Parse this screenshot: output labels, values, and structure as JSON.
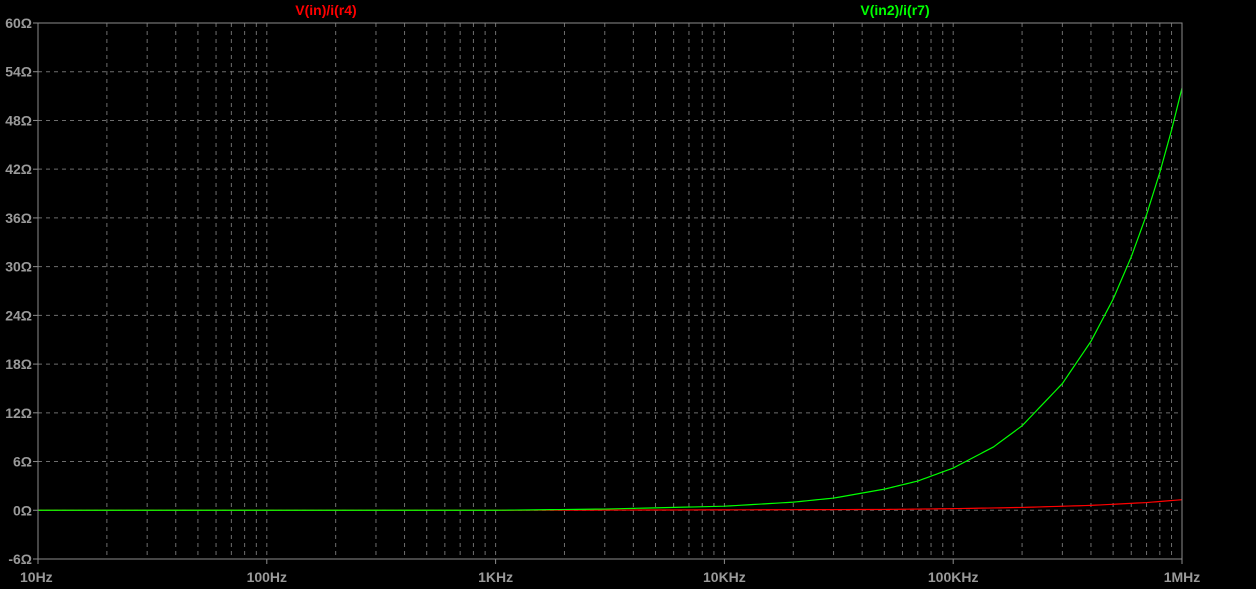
{
  "chart_data": {
    "type": "line",
    "x_scale": "log",
    "xlim": [
      10,
      1000000
    ],
    "ylim": [
      -6,
      60
    ],
    "grid": true,
    "x_ticks": [
      {
        "value": 10,
        "label": "10Hz"
      },
      {
        "value": 100,
        "label": "100Hz"
      },
      {
        "value": 1000,
        "label": "1KHz"
      },
      {
        "value": 10000,
        "label": "10KHz"
      },
      {
        "value": 100000,
        "label": "100KHz"
      },
      {
        "value": 1000000,
        "label": "1MHz"
      }
    ],
    "y_ticks": [
      {
        "value": -6,
        "label": "-6Ω"
      },
      {
        "value": 0,
        "label": "0Ω"
      },
      {
        "value": 6,
        "label": "6Ω"
      },
      {
        "value": 12,
        "label": "12Ω"
      },
      {
        "value": 18,
        "label": "18Ω"
      },
      {
        "value": 24,
        "label": "24Ω"
      },
      {
        "value": 30,
        "label": "30Ω"
      },
      {
        "value": 36,
        "label": "36Ω"
      },
      {
        "value": 42,
        "label": "42Ω"
      },
      {
        "value": 48,
        "label": "48Ω"
      },
      {
        "value": 54,
        "label": "54Ω"
      },
      {
        "value": 60,
        "label": "60Ω"
      }
    ],
    "series": [
      {
        "name": "V(in)/i(r4)",
        "color": "#ff0000",
        "x": [
          10,
          100,
          1000,
          10000,
          50000,
          100000,
          200000,
          400000,
          700000,
          1000000
        ],
        "y": [
          0.0,
          0.0,
          0.0,
          0.05,
          0.1,
          0.2,
          0.35,
          0.6,
          0.95,
          1.3
        ]
      },
      {
        "name": "V(in2)/i(r7)",
        "color": "#00ff00",
        "x": [
          10,
          100,
          1000,
          3000,
          10000,
          20000,
          30000,
          50000,
          70000,
          100000,
          150000,
          200000,
          300000,
          400000,
          500000,
          600000,
          700000,
          800000,
          900000,
          1000000
        ],
        "y": [
          0.0,
          0.0,
          0.0,
          0.15,
          0.5,
          1.0,
          1.5,
          2.6,
          3.6,
          5.2,
          7.8,
          10.4,
          15.6,
          20.8,
          26.0,
          31.2,
          36.4,
          41.6,
          46.8,
          52.0
        ]
      }
    ]
  }
}
